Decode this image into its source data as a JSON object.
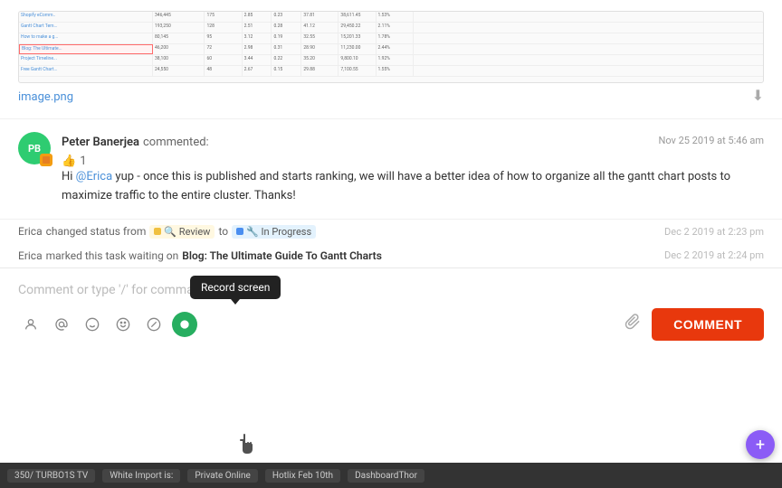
{
  "image": {
    "filename": "image.png",
    "download_label": "⬇"
  },
  "comment": {
    "author": "Peter Banerjea",
    "action": "commented:",
    "timestamp": "Nov 25 2019 at 5:46 am",
    "text_pre": "Hi ",
    "mention": "@Erica",
    "text_post": " yup - once this is published and starts ranking, we will have a better idea of how to organize all the gantt chart posts to maximize traffic to the entire cluster. Thanks!",
    "like_count": "1"
  },
  "activities": [
    {
      "actor": "Erica",
      "action_pre": "changed status from",
      "from_status": "Review",
      "to_label": "to",
      "to_status": "In Progress",
      "timestamp": "Dec 2 2019 at 2:23 pm"
    },
    {
      "actor": "Erica",
      "action_pre": "marked this task waiting on",
      "task_link": "Blog: The Ultimate Guide To Gantt Charts",
      "timestamp": "Dec 2 2019 at 2:24 pm"
    }
  ],
  "input": {
    "placeholder": "Comment or type '/' for commands"
  },
  "tooltip": {
    "label": "Record screen"
  },
  "toolbar": {
    "icons": [
      {
        "name": "person-icon",
        "glyph": "👤"
      },
      {
        "name": "at-icon",
        "glyph": "@"
      },
      {
        "name": "smiley-icon",
        "glyph": "🙂"
      },
      {
        "name": "emoji-icon",
        "glyph": "😊"
      },
      {
        "name": "slash-icon",
        "glyph": "/"
      },
      {
        "name": "record-icon",
        "glyph": "⏺"
      }
    ],
    "attach_icon": "📎",
    "comment_button": "COMMENT"
  },
  "taskbar": {
    "items": [
      "350/ TURBO1S TV",
      "White Import is:",
      "Private Online",
      "Hotlix Feb 10th",
      "DashboardThor"
    ]
  },
  "avatar": {
    "initials": "PB"
  }
}
